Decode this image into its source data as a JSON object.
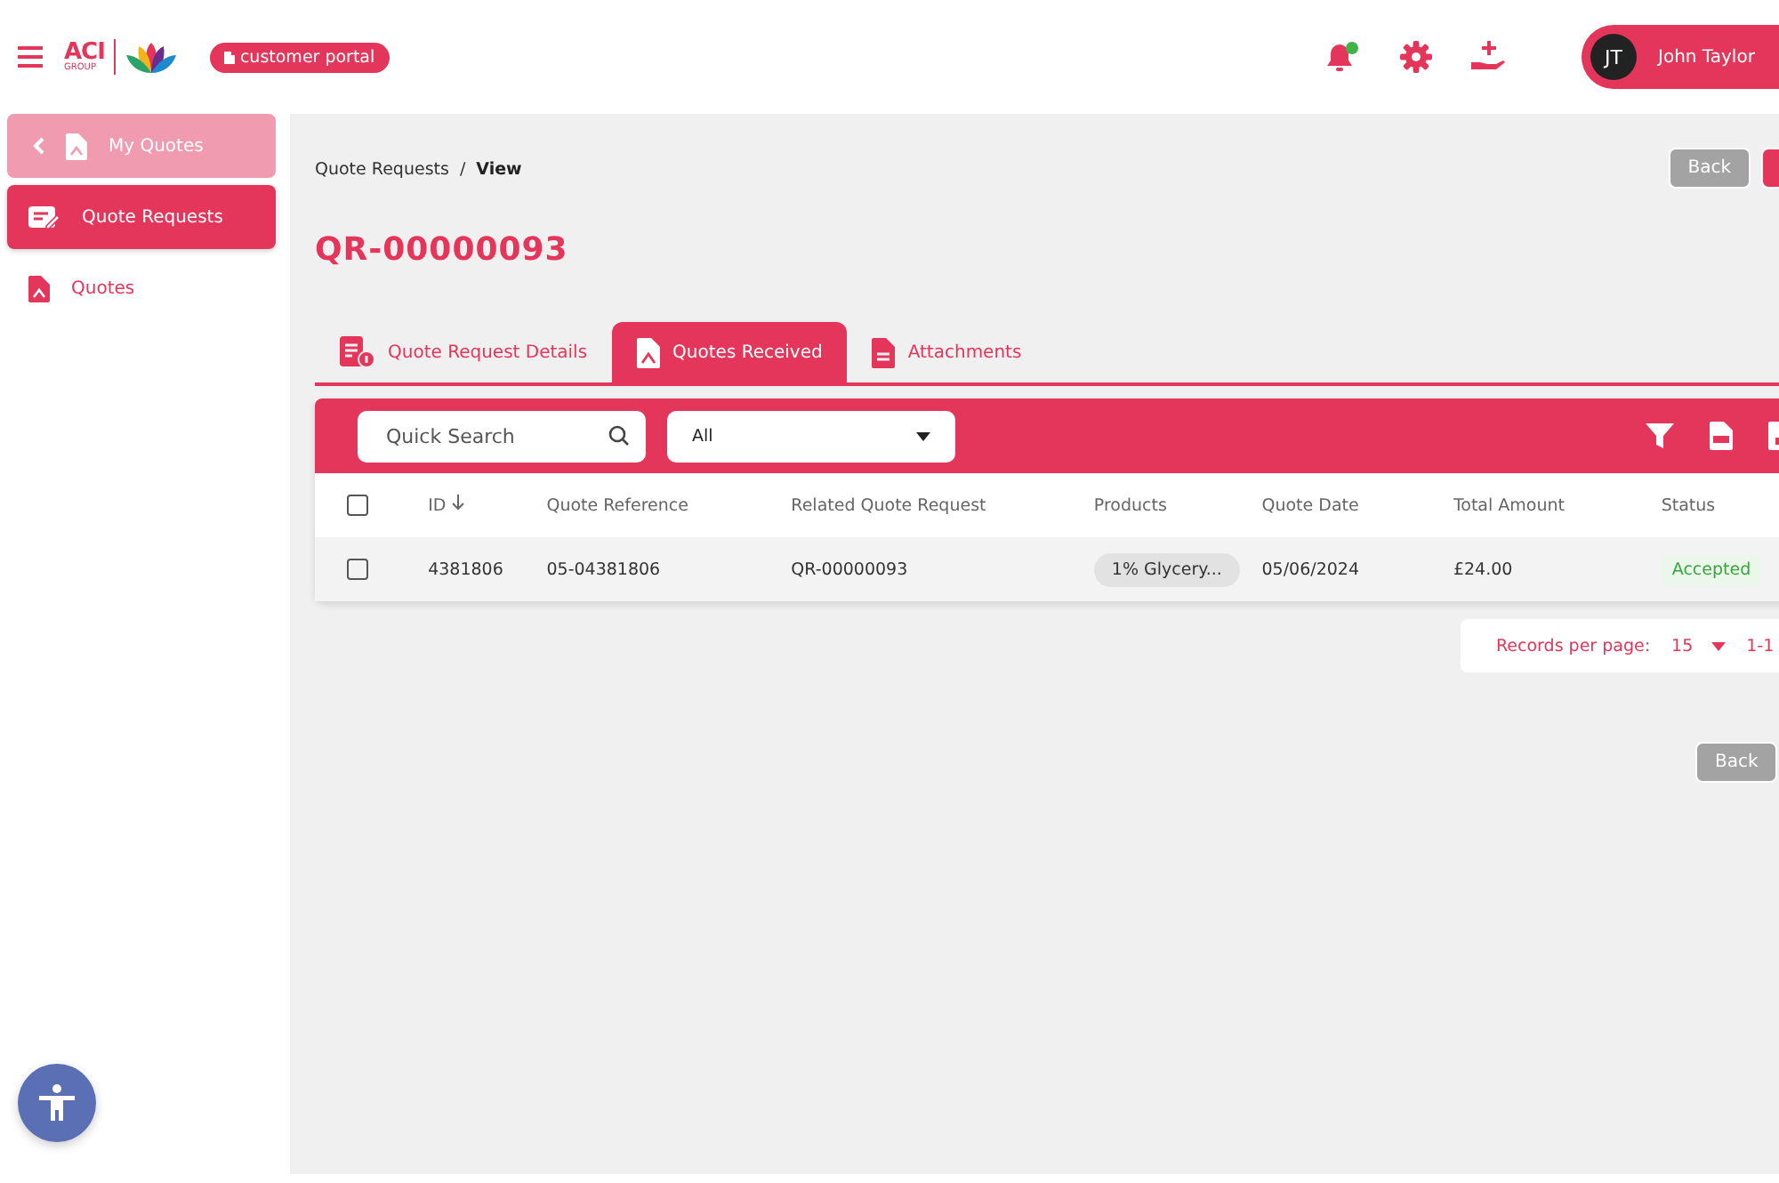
{
  "header": {
    "logo": {
      "name": "ACI",
      "sub": "GROUP"
    },
    "portal_badge": "customer portal",
    "notification_dot": true,
    "user": {
      "initials": "JT",
      "name": "John Taylor"
    }
  },
  "sidebar": {
    "items": [
      {
        "label": "My Quotes",
        "kind": "back",
        "selected": false
      },
      {
        "label": "Quote Requests",
        "kind": "request",
        "selected": true
      },
      {
        "label": "Quotes",
        "kind": "quote",
        "selected": false
      }
    ]
  },
  "breadcrumb": {
    "items": [
      "Quote Requests",
      "View"
    ],
    "separator": "/"
  },
  "title": "QR-00000093",
  "top_buttons": [
    {
      "label": "Back",
      "kind": "secondary"
    },
    {
      "kind": "primary"
    }
  ],
  "tabs": [
    {
      "label": "Quote Request Details",
      "kind": "details",
      "selected": false
    },
    {
      "label": "Quotes Received",
      "kind": "received",
      "selected": true
    },
    {
      "label": "Attachments",
      "kind": "attachments",
      "selected": false
    }
  ],
  "toolbar": {
    "search": {
      "placeholder": "Quick Search"
    },
    "filter_value": "All"
  },
  "table": {
    "columns": [
      {
        "label": "ID",
        "sorted": true
      },
      {
        "label": "Quote Reference",
        "sorted": false
      },
      {
        "label": "Related Quote Request",
        "sorted": false
      },
      {
        "label": "Products",
        "sorted": false
      },
      {
        "label": "Quote Date",
        "sorted": false
      },
      {
        "label": "Total Amount",
        "sorted": false
      },
      {
        "label": "Status",
        "sorted": false
      }
    ],
    "all_checked": false,
    "rows": [
      {
        "checked": false,
        "id": "4381806",
        "reference": "05-04381806",
        "request": "QR-00000093",
        "products": "1% Glycery...",
        "date": "05/06/2024",
        "amount": "£24.00",
        "status": {
          "text": "Accepted",
          "kind": "accepted"
        }
      }
    ]
  },
  "pagination": {
    "label": "Records per page:",
    "per_page": "15",
    "range": "1-1"
  },
  "bottom_button": "Back"
}
